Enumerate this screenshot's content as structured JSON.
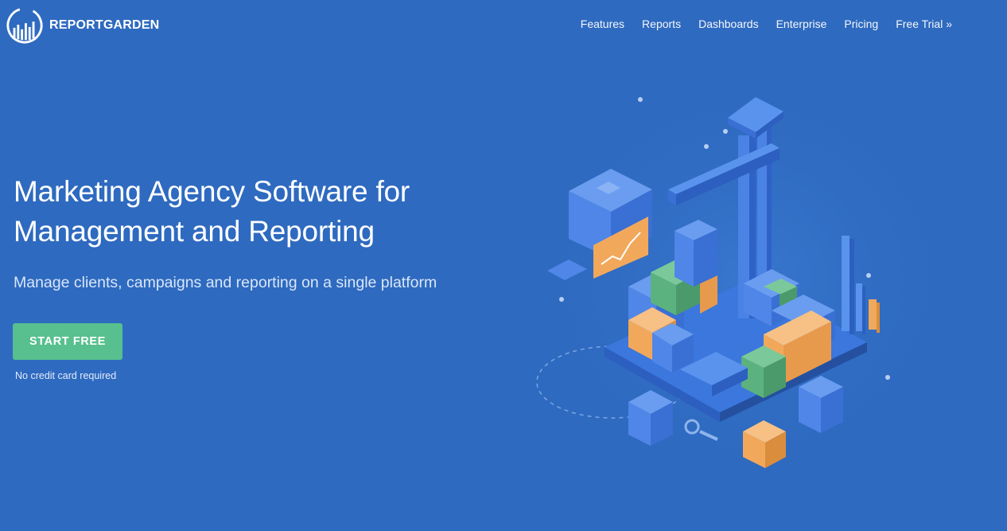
{
  "brand": {
    "name": "REPORTGARDEN",
    "logo_icon": "bar-chart-circle-logo"
  },
  "nav": {
    "items": [
      {
        "label": "Features"
      },
      {
        "label": "Reports"
      },
      {
        "label": "Dashboards"
      },
      {
        "label": "Enterprise"
      },
      {
        "label": "Pricing"
      },
      {
        "label": "Free Trial »"
      }
    ]
  },
  "hero": {
    "title_line1": "Marketing Agency Software for",
    "title_line2": "Management and Reporting",
    "subtitle": "Manage clients, campaigns and reporting on a single platform",
    "cta_label": "START FREE",
    "cta_note": "No credit card required"
  },
  "colors": {
    "background": "#2e6ac0",
    "cta": "#57c08e",
    "block_blue": "#4f86e8",
    "block_orange": "#f2a85b",
    "block_green": "#5bb27e"
  }
}
